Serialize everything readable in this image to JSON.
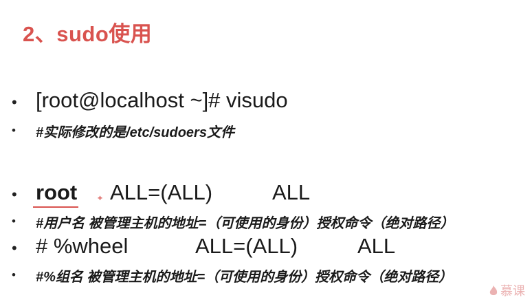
{
  "slide": {
    "title": "2、sudo使用",
    "lines": {
      "cmd": "[root@localhost ~]# visudo",
      "cmd_note": "#实际修改的是/etc/sudoers文件",
      "user_name": "root",
      "user_hosts": "ALL=(ALL)",
      "user_cmds": "ALL",
      "user_note": "#用户名 被管理主机的地址=（可使用的身份）授权命令（绝对路径）",
      "group_name": "# %wheel",
      "group_hosts": "ALL=(ALL)",
      "group_cmds": "ALL",
      "group_note": "#%组名 被管理主机的地址=（可使用的身份）授权命令（绝对路径）"
    },
    "bullet_symbol": "•",
    "cursor_symbol": "+",
    "watermark": "慕课"
  }
}
